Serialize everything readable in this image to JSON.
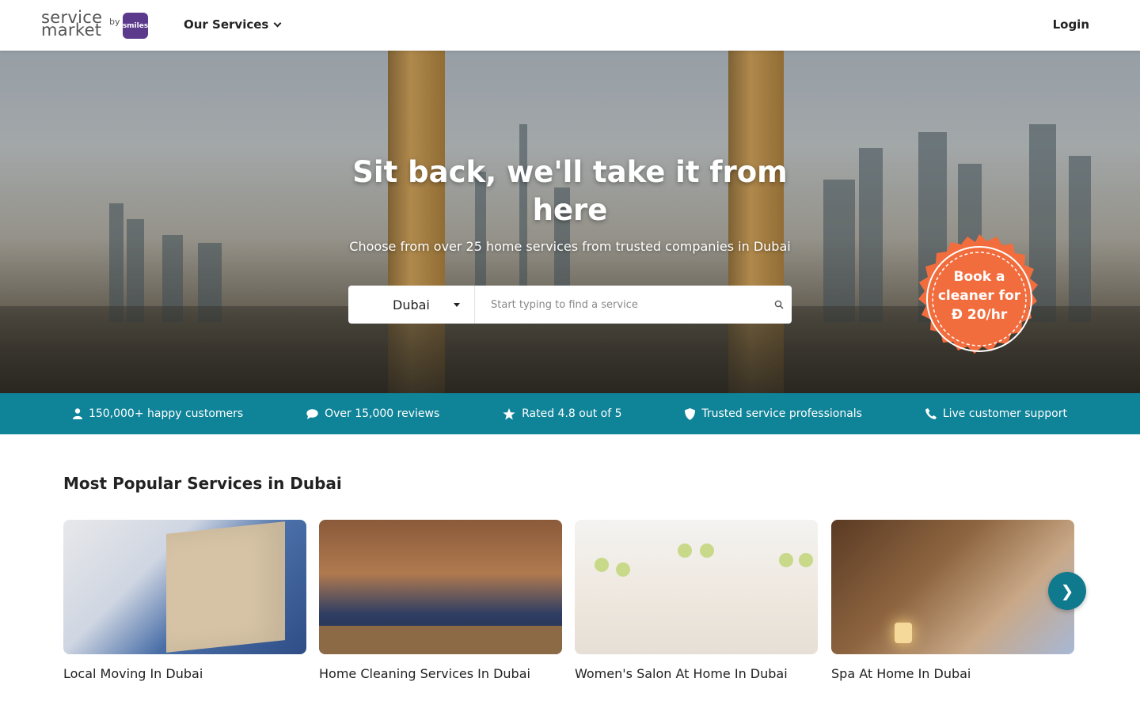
{
  "header": {
    "logo_line1": "service",
    "logo_line2": "market",
    "logo_by": "by",
    "logo_partner": "smiles",
    "services_label": "Our Services",
    "login_label": "Login"
  },
  "hero": {
    "title": "Sit back, we'll take it from here",
    "subtitle": "Choose from over 25 home services from trusted companies in Dubai",
    "city_selected": "Dubai",
    "search_placeholder": "Start typing to find a service",
    "badge_line1": "Book a",
    "badge_line2": "cleaner for",
    "badge_line3": "Đ 20/hr"
  },
  "trust_bar": {
    "items": [
      {
        "label": "150,000+ happy customers",
        "icon": "user-icon"
      },
      {
        "label": "Over 15,000 reviews",
        "icon": "chat-bubble-icon"
      },
      {
        "label": "Rated 4.8 out of 5",
        "icon": "star-icon"
      },
      {
        "label": "Trusted service professionals",
        "icon": "shield-icon"
      },
      {
        "label": "Live customer support",
        "icon": "phone-icon"
      }
    ]
  },
  "popular": {
    "title": "Most Popular Services in Dubai",
    "cards": [
      {
        "title": "Local Moving In Dubai"
      },
      {
        "title": "Home Cleaning Services In Dubai"
      },
      {
        "title": "Women's Salon At Home In Dubai"
      },
      {
        "title": "Spa At Home In Dubai"
      }
    ],
    "next_label": "❯"
  },
  "colors": {
    "trust_bar": "#0f8398",
    "badge": "#f26d3d",
    "next_button": "#0f7a8e",
    "smiles_brand": "#5b3a8c"
  }
}
